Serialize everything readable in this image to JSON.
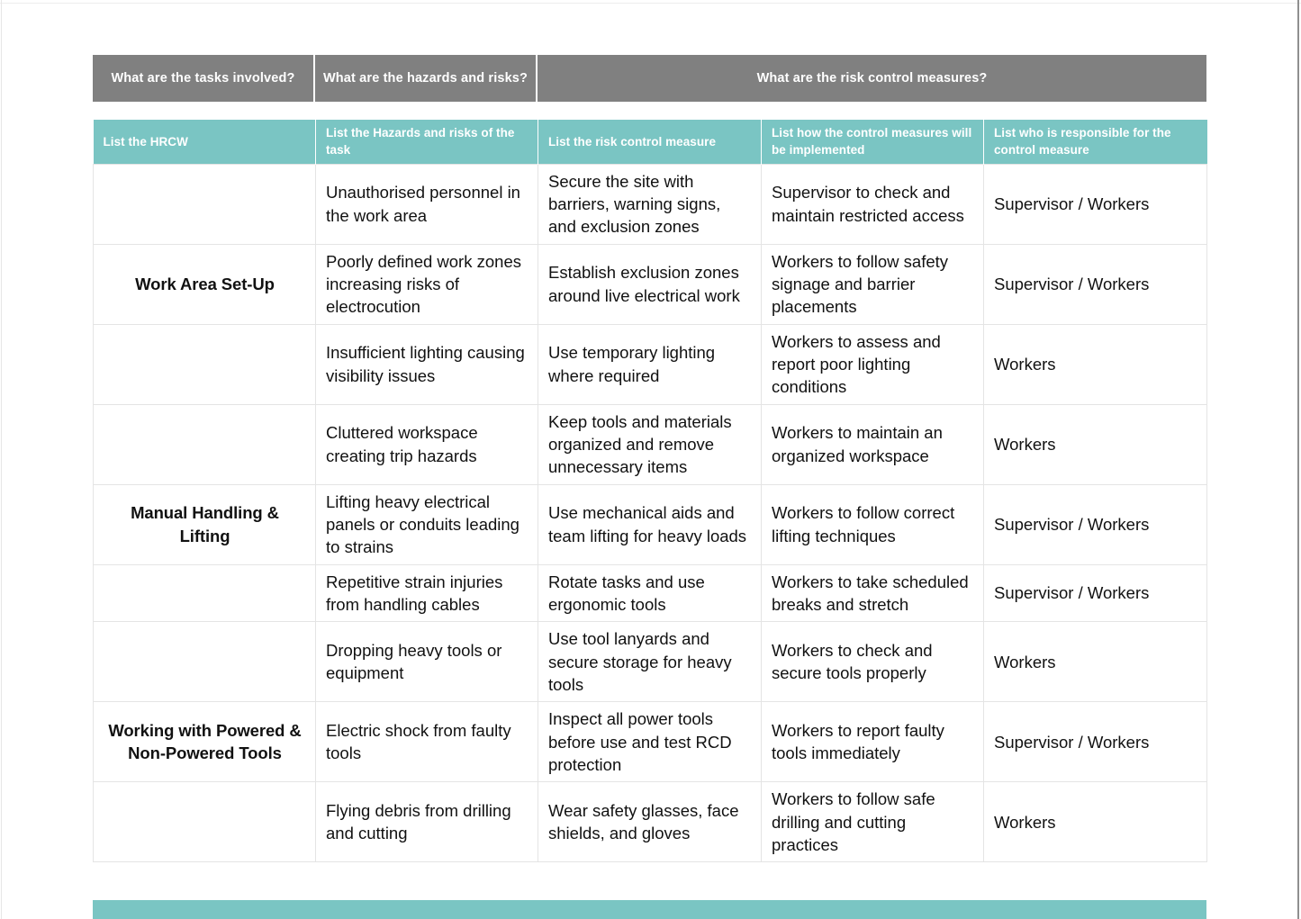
{
  "colors": {
    "super_header_bg": "#808080",
    "column_header_bg": "#7ac5c3",
    "cell_border": "#e4e4e4",
    "text": "#111111",
    "header_text": "#ffffff"
  },
  "super_headers": [
    {
      "label": "What are the tasks involved?"
    },
    {
      "label": "What are the hazards and risks?"
    },
    {
      "label": "What are the risk control measures?"
    }
  ],
  "column_headers": [
    {
      "label": "List the HRCW"
    },
    {
      "label": "List the Hazards and risks of the task"
    },
    {
      "label": "List the risk control measure"
    },
    {
      "label": "List how the control measures will be implemented"
    },
    {
      "label": "List who is responsible for the control measure"
    }
  ],
  "rows": [
    {
      "hrcw": "",
      "hazard": "Unauthorised personnel in the work area",
      "control": "Secure the site with barriers, warning signs, and exclusion zones",
      "implementation": "Supervisor to check and maintain restricted access",
      "responsible": "Supervisor / Workers"
    },
    {
      "hrcw": "Work Area Set-Up",
      "hazard": "Poorly defined work zones increasing risks of electrocution",
      "control": "Establish exclusion zones around live electrical work",
      "implementation": "Workers to follow safety signage and barrier placements",
      "responsible": "Supervisor / Workers"
    },
    {
      "hrcw": "",
      "hazard": "Insufficient lighting causing visibility issues",
      "control": "Use temporary lighting where required",
      "implementation": "Workers to assess and report poor lighting conditions",
      "responsible": "Workers"
    },
    {
      "hrcw": "",
      "hazard": "Cluttered workspace creating trip hazards",
      "control": "Keep tools and materials organized and remove unnecessary items",
      "implementation": "Workers to maintain an organized workspace",
      "responsible": "Workers"
    },
    {
      "hrcw": "Manual Handling & Lifting",
      "hazard": "Lifting heavy electrical panels or conduits leading to strains",
      "control": "Use mechanical aids and team lifting for heavy loads",
      "implementation": "Workers to follow correct lifting techniques",
      "responsible": "Supervisor / Workers"
    },
    {
      "hrcw": "",
      "hazard": "Repetitive strain injuries from handling cables",
      "control": "Rotate tasks and use ergonomic tools",
      "implementation": "Workers to take scheduled breaks and stretch",
      "responsible": "Supervisor / Workers"
    },
    {
      "hrcw": "",
      "hazard": "Dropping heavy tools or equipment",
      "control": "Use tool lanyards and secure storage for heavy tools",
      "implementation": "Workers to check and secure tools properly",
      "responsible": "Workers"
    },
    {
      "hrcw": "Working with Powered & Non-Powered Tools",
      "hazard": "Electric shock from faulty tools",
      "control": "Inspect all power tools before use and test RCD protection",
      "implementation": "Workers to report faulty tools immediately",
      "responsible": "Supervisor / Workers"
    },
    {
      "hrcw": "",
      "hazard": "Flying debris from drilling and cutting",
      "control": "Wear safety glasses, face shields, and gloves",
      "implementation": "Workers to follow safe drilling and cutting practices",
      "responsible": "Workers"
    }
  ]
}
